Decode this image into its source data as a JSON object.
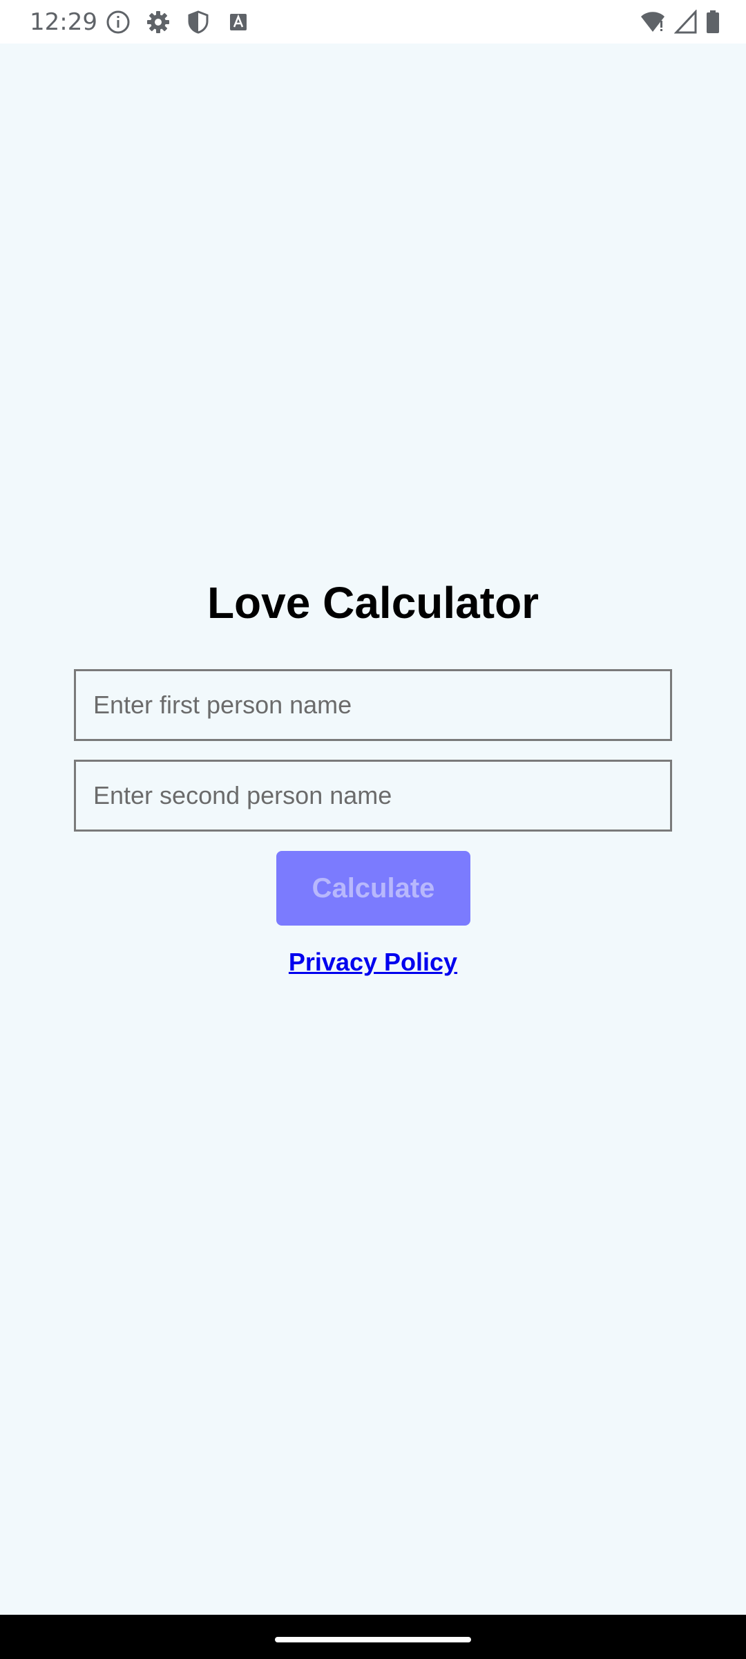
{
  "status_bar": {
    "time": "12:29",
    "icons_left": [
      "info-icon",
      "gear-icon",
      "shield-icon",
      "text-a-icon"
    ],
    "icons_right": [
      "wifi-alert-icon",
      "signal-icon",
      "battery-icon"
    ]
  },
  "app": {
    "title": "Love Calculator",
    "first_input": {
      "placeholder": "Enter first person name",
      "value": ""
    },
    "second_input": {
      "placeholder": "Enter second person name",
      "value": ""
    },
    "calculate_label": "Calculate",
    "privacy_label": "Privacy Policy"
  },
  "colors": {
    "background": "#f2f9fc",
    "button_bg": "#7b7bfe",
    "button_text": "#b8b8fc",
    "link": "#0000ee",
    "title": "#000000"
  }
}
